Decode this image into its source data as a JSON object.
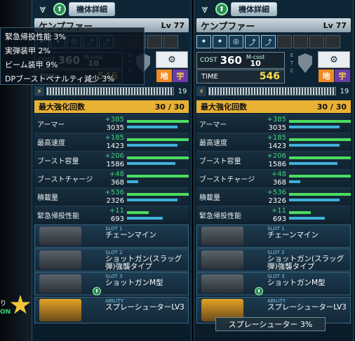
{
  "panels": [
    {
      "title": "機体詳細",
      "name": "ケンプファー",
      "level": "Lv 77",
      "cost_label": "COST",
      "cost": "360",
      "mcost_label": "M-cost",
      "mcost": "10",
      "time_label": "TIME",
      "time": "546",
      "gauge_value": "19",
      "terrain_ground": "地",
      "terrain_space": "宇",
      "max_enhance_label": "最大強化回数",
      "max_enhance_value": "30 / 30"
    }
  ],
  "stats": [
    {
      "label": "アーマー",
      "plus": "+385",
      "base": "3035"
    },
    {
      "label": "最高速度",
      "plus": "+185",
      "base": "1423"
    },
    {
      "label": "ブースト容量",
      "plus": "+206",
      "base": "1586"
    },
    {
      "label": "ブーストチャージ",
      "plus": "+48",
      "base": "368"
    },
    {
      "label": "積載量",
      "plus": "+536",
      "base": "2326"
    },
    {
      "label": "緊急帰投性能",
      "plus": "+11",
      "base": "693"
    }
  ],
  "slots": [
    {
      "tag": "SLOT 1",
      "name": "チェーンマイン"
    },
    {
      "tag": "SLOT 2",
      "name": "ショットガン(スラッグ弾)強襲タイプ"
    },
    {
      "tag": "SLOT 3",
      "name": "ショットガンM型"
    },
    {
      "tag": "ABILITY",
      "name": "スプレーシューターLV3"
    }
  ],
  "tooltip_left": [
    "緊急帰投性能 3%",
    "実弾装甲 2%",
    "ビーム装甲 9%",
    "DPブーストペナルティ減少 3%"
  ],
  "tooltip_bottom": "スプレーシューター 3%",
  "left_edge": {
    "line1": "り",
    "line2": "ON"
  }
}
